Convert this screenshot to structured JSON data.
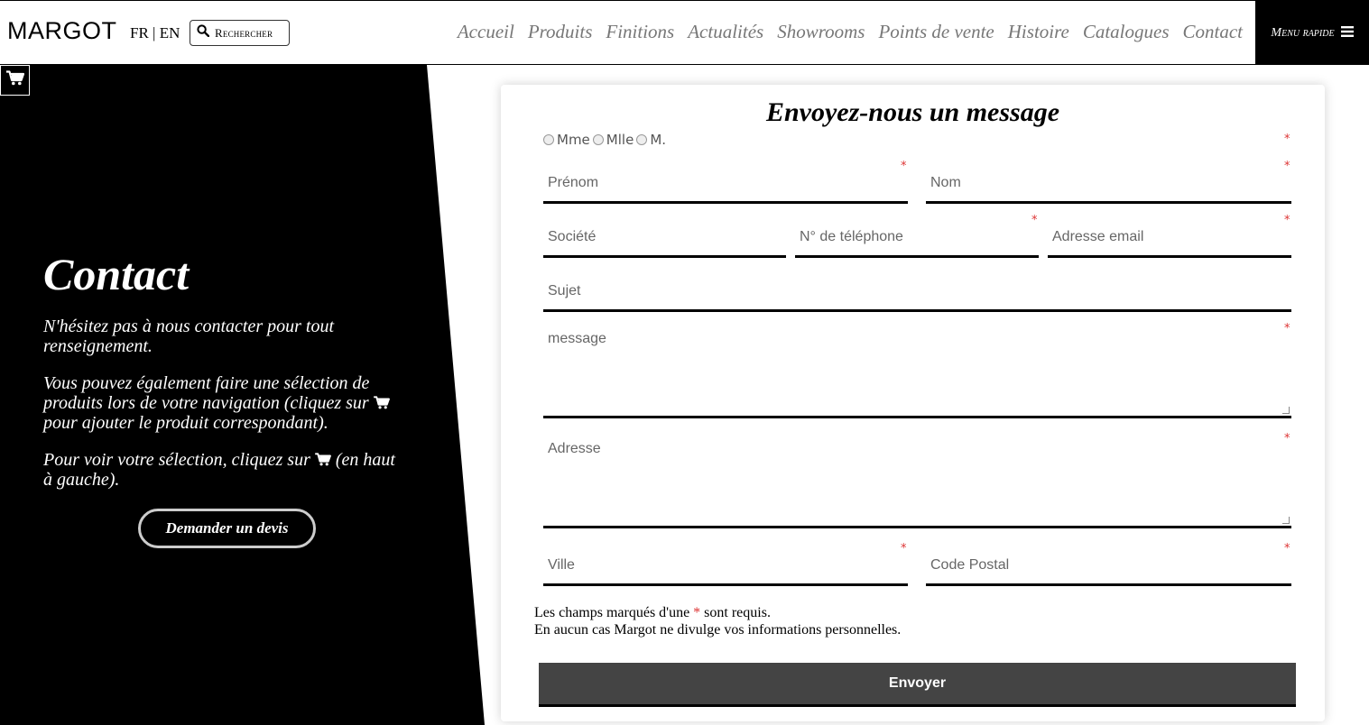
{
  "header": {
    "logo": "MARGOT",
    "lang_fr": "FR",
    "lang_sep": "|",
    "lang_en": "EN",
    "search_label": "Rechercher",
    "nav": [
      "Accueil",
      "Produits",
      "Finitions",
      "Actualités",
      "Showrooms",
      "Points de vente",
      "Histoire",
      "Catalogues",
      "Contact"
    ],
    "quick_menu": "Menu rapide"
  },
  "left": {
    "title": "Contact",
    "p1": "N'hésitez pas à nous contacter pour tout renseignement.",
    "p2_before": "Vous pouvez également faire une sélection de produits lors de votre navigation (cliquez sur",
    "p2_after": "pour ajouter le produit correspondant).",
    "p3_before": "Pour voir votre sélection, cliquez sur",
    "p3_after": "(en haut à gauche).",
    "quote_button": "Demander un devis"
  },
  "form": {
    "title": "Envoyez-nous un message",
    "civility": [
      "Mme",
      "Mlle",
      "M."
    ],
    "firstname_placeholder": "Prénom",
    "lastname_placeholder": "Nom",
    "company_placeholder": "Société",
    "phone_placeholder": "N° de téléphone",
    "email_placeholder": "Adresse email",
    "subject_placeholder": "Sujet",
    "message_placeholder": "message",
    "address_placeholder": "Adresse",
    "city_placeholder": "Ville",
    "zip_placeholder": "Code Postal",
    "required_mark": "*",
    "note_line1_before": "Les champs marqués d'une",
    "note_line1_after": "sont requis.",
    "note_line2": "En aucun cas Margot ne divulge vos informations personnelles.",
    "submit": "Envoyer"
  },
  "colors": {
    "required": "#d33333",
    "nav_text": "#777777",
    "submit_bg": "#444444"
  },
  "icons": [
    "search-icon",
    "menu-icon",
    "cart-icon"
  ]
}
